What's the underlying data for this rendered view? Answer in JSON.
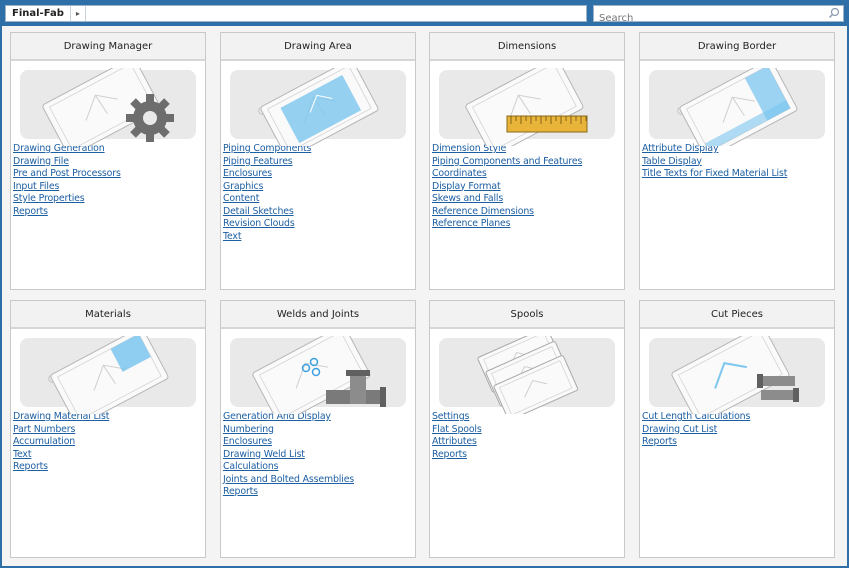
{
  "topbar": {
    "breadcrumb": "Final-Fab",
    "breadcrumb_arrow": "▸",
    "search_placeholder": "Search"
  },
  "cards": [
    {
      "title": "Drawing Manager",
      "illustration": "drawing-gear-icon",
      "links": [
        "Drawing Generation",
        "Drawing File",
        "Pre and Post Processors",
        "Input Files",
        "Style Properties",
        "Reports"
      ]
    },
    {
      "title": "Drawing Area",
      "illustration": "drawing-area-icon",
      "links": [
        "Piping Components",
        "Piping Features",
        "Enclosures",
        "Graphics",
        "Content",
        "Detail Sketches",
        "Revision Clouds",
        "Text"
      ]
    },
    {
      "title": "Dimensions",
      "illustration": "drawing-ruler-icon",
      "links": [
        "Dimension Style",
        "Piping Components and Features",
        "Coordinates",
        "Display Format",
        "Skews and Falls",
        "Reference Dimensions",
        "Reference Planes"
      ]
    },
    {
      "title": "Drawing Border",
      "illustration": "drawing-border-icon",
      "links": [
        "Attribute Display",
        "Table Display",
        "Title Texts for Fixed Material List"
      ]
    },
    {
      "title": "Materials",
      "illustration": "drawing-materials-icon",
      "links": [
        "Drawing Material List",
        "Part Numbers",
        "Accumulation",
        "Text",
        "Reports"
      ]
    },
    {
      "title": "Welds and Joints",
      "illustration": "drawing-pipe-tee-icon",
      "links": [
        "Generation And Display",
        "Numbering",
        "Enclosures",
        "Drawing Weld List",
        "Calculations",
        "Joints and Bolted Assemblies",
        "Reports"
      ]
    },
    {
      "title": "Spools",
      "illustration": "drawing-stack-icon",
      "links": [
        "Settings",
        "Flat Spools",
        "Attributes",
        "Reports"
      ]
    },
    {
      "title": "Cut Pieces",
      "illustration": "drawing-cut-pipe-icon",
      "links": [
        "Cut Length Calculations",
        "Drawing Cut List",
        "Reports"
      ]
    }
  ],
  "colors": {
    "link": "#1d5fa3",
    "accent": "#2f6fa8",
    "highlight": "#7cc6ef"
  }
}
